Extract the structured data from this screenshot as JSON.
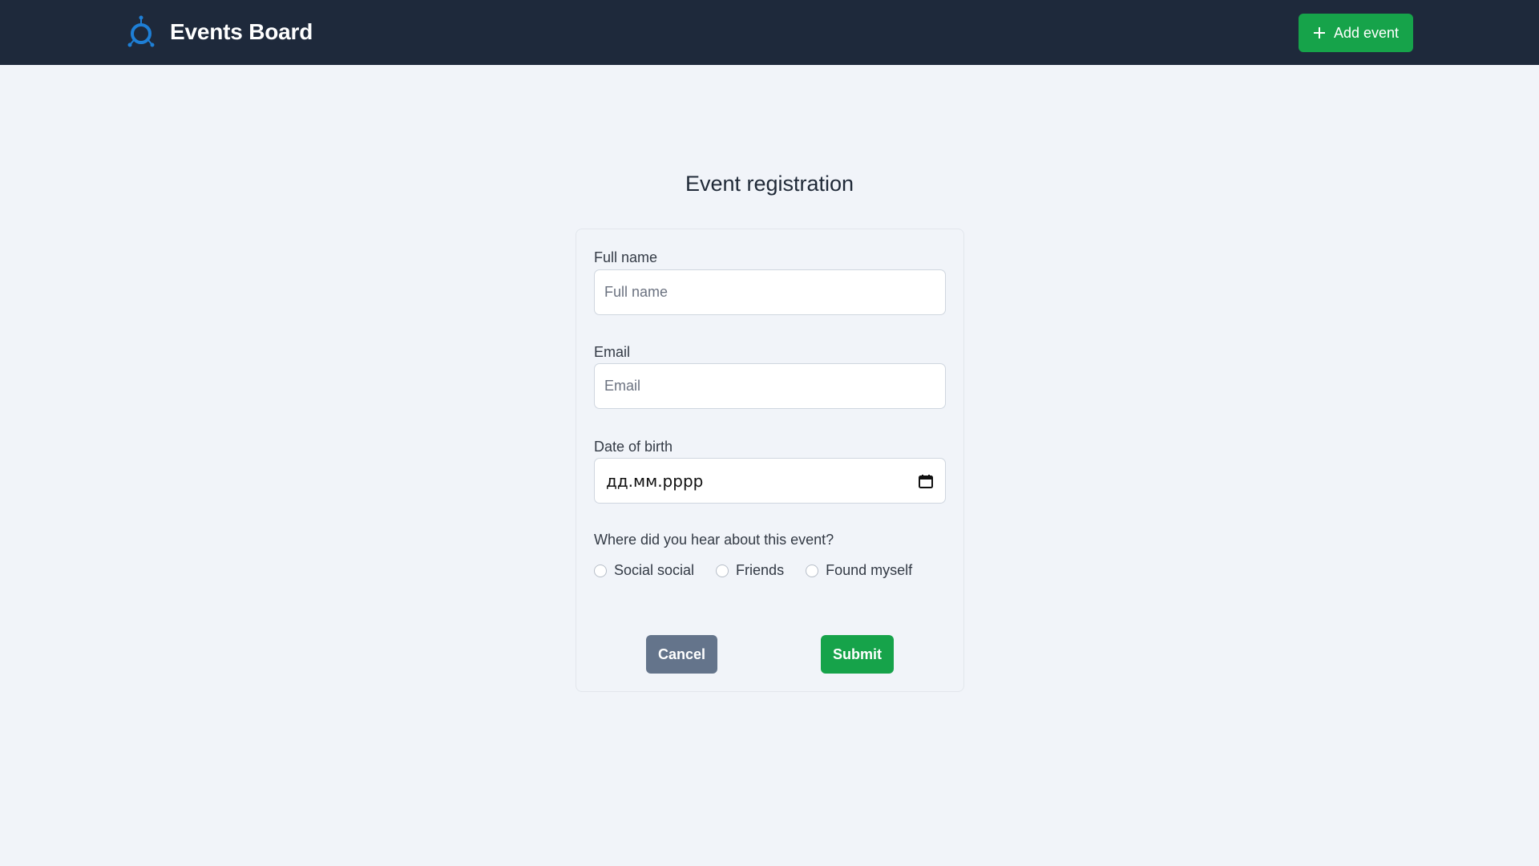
{
  "header": {
    "app_title": "Events Board",
    "logo_icon": "atom-logo-icon",
    "add_event_label": "Add event",
    "add_event_icon": "plus-icon",
    "bg_color": "#1e293b",
    "accent_color": "#16a34a"
  },
  "form": {
    "title": "Event registration",
    "full_name": {
      "label": "Full name",
      "placeholder": "Full name",
      "value": ""
    },
    "email": {
      "label": "Email",
      "placeholder": "Email",
      "value": ""
    },
    "date_of_birth": {
      "label": "Date of birth",
      "placeholder": "дд.мм.рррр",
      "icon": "calendar-icon"
    },
    "source_question": "Where did you hear about this event?",
    "source_options": [
      {
        "label": "Social social",
        "checked": false
      },
      {
        "label": "Friends",
        "checked": false
      },
      {
        "label": "Found myself",
        "checked": false
      }
    ],
    "cancel_label": "Cancel",
    "submit_label": "Submit",
    "cancel_color": "#64748b",
    "submit_color": "#16a34a"
  }
}
